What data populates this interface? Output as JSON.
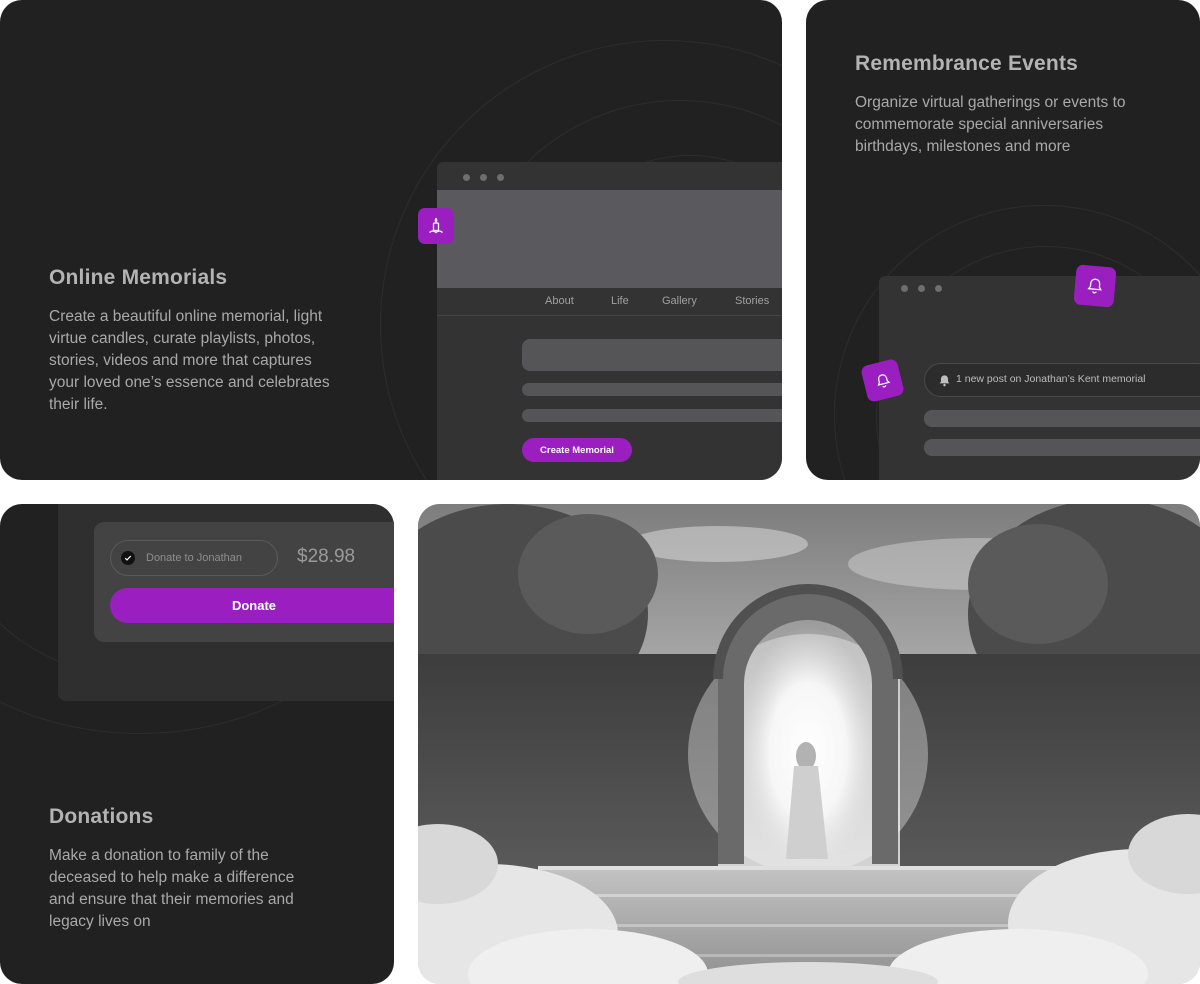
{
  "memorials": {
    "title": "Online Memorials",
    "description": "Create a beautiful online memorial, light virtue candles, curate playlists, photos, stories, videos and more that captures your loved one’s essence and celebrates their life.",
    "nav": [
      "About",
      "Life",
      "Gallery",
      "Stories"
    ],
    "cta": "Create Memorial",
    "badge_icon": "candle-icon"
  },
  "events": {
    "title": "Remembrance Events",
    "description": "Organize virtual gatherings or events to commemorate special anniversaries birthdays, milestones and more",
    "notification": "1 new post on Jonathan’s Kent memorial",
    "badge_icon": "bell-icon"
  },
  "donations": {
    "title": "Donations",
    "description": "Make a donation to family of the deceased to help make a difference and ensure that their memories and legacy lives on",
    "option_label": "Donate to Jonathan",
    "amount": "$28.98",
    "button": "Donate"
  },
  "colors": {
    "accent": "#9b1fc0",
    "card_bg": "#212121",
    "window_bg": "#333333"
  }
}
